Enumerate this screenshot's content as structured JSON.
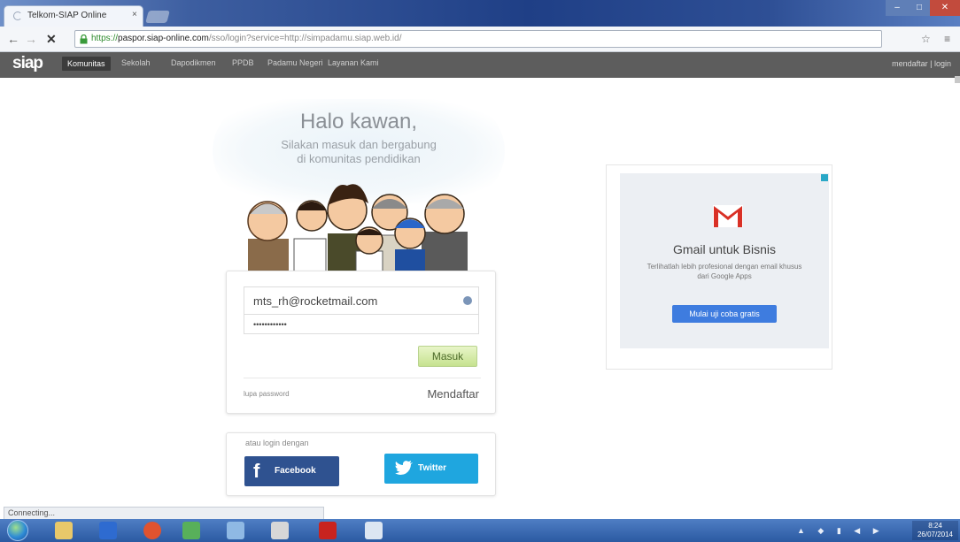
{
  "browser": {
    "tab_title": "Telkom-SIAP Online",
    "tab_close": "×",
    "url_scheme": "https://",
    "url_host": "paspor.siap-online.com",
    "url_rest": "/sso/login?service=http://simpadamu.siap.web.id/",
    "back": "←",
    "forward": "→",
    "stop": "✕",
    "toolbar_icons": "☆ ≡",
    "window_controls": {
      "minimize": "–",
      "maximize": "□",
      "close": "✕"
    }
  },
  "site": {
    "logo": "siap",
    "nav": [
      "Komunitas",
      "Sekolah",
      "Dapodikmen",
      "PPDB",
      "Padamu Negeri",
      "Layanan Kami"
    ],
    "nav_user": "mendaftar | login"
  },
  "hero": {
    "title": "Halo kawan,",
    "subtitle_line1": "Silakan masuk dan bergabung",
    "subtitle_line2": "di komunitas pendidikan"
  },
  "login": {
    "email_value": "mts_rh@rocketmail.com",
    "password_value": "••••••••••••",
    "submit_label": "Masuk",
    "forgot_label": "lupa password",
    "register_label": "Mendaftar"
  },
  "social": {
    "label": "atau login dengan",
    "facebook_label": "Facebook",
    "twitter_label": "Twitter"
  },
  "ad": {
    "title": "Gmail untuk Bisnis",
    "body": "Terlihatlah lebih profesional dengan email khusus dari Google Apps",
    "cta": "Mulai uji coba gratis"
  },
  "status": {
    "text": "Connecting..."
  },
  "taskbar": {
    "clock_time": "8:24",
    "clock_date": "26/07/2014"
  },
  "colors": {
    "nav_bg": "#5d5d5d",
    "facebook": "#2f5290",
    "twitter": "#1fa6df",
    "masuk_green": "#c6e28f",
    "ad_cta": "#3e7cdf",
    "gmail_red": "#d93025"
  }
}
